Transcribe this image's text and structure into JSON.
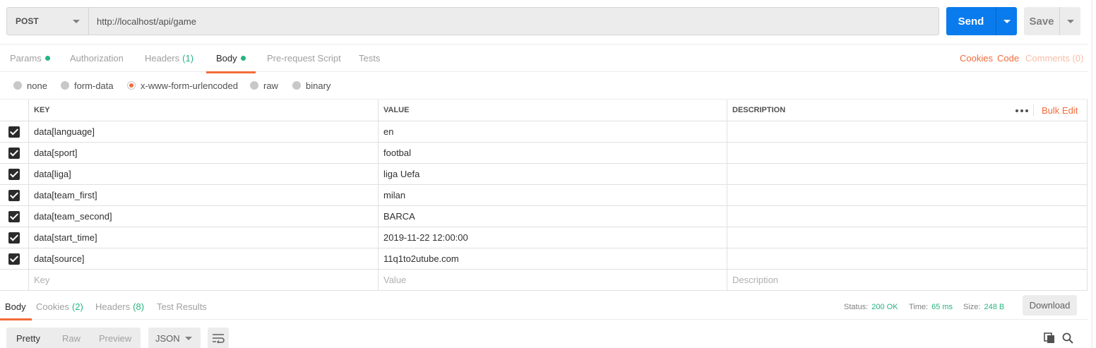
{
  "request": {
    "method": "POST",
    "url": "http://localhost/api/game",
    "send_label": "Send",
    "save_label": "Save"
  },
  "tabs": {
    "params": "Params",
    "authorization": "Authorization",
    "headers": "Headers",
    "headers_count": "(1)",
    "body": "Body",
    "prerequest": "Pre-request Script",
    "tests": "Tests",
    "active": "Body"
  },
  "links": {
    "cookies": "Cookies",
    "code": "Code",
    "comments": "Comments (0)"
  },
  "body_types": {
    "none": "none",
    "form_data": "form-data",
    "urlencoded": "x-www-form-urlencoded",
    "raw": "raw",
    "binary": "binary",
    "selected": "x-www-form-urlencoded"
  },
  "table": {
    "headers": {
      "key": "KEY",
      "value": "VALUE",
      "description": "DESCRIPTION"
    },
    "bulk_edit": "Bulk Edit",
    "rows": [
      {
        "key": "data[language]",
        "value": "en",
        "description": "",
        "checked": true
      },
      {
        "key": "data[sport]",
        "value": "footbal",
        "description": "",
        "checked": true
      },
      {
        "key": "data[liga]",
        "value": "liga Uefa",
        "description": "",
        "checked": true
      },
      {
        "key": "data[team_first]",
        "value": "milan",
        "description": "",
        "checked": true
      },
      {
        "key": "data[team_second]",
        "value": "BARCA",
        "description": "",
        "checked": true
      },
      {
        "key": "data[start_time]",
        "value": "2019-11-22 12:00:00",
        "description": "",
        "checked": true
      },
      {
        "key": "data[source]",
        "value": "11q1to2utube.com",
        "description": "",
        "checked": true
      }
    ],
    "placeholders": {
      "key": "Key",
      "value": "Value",
      "description": "Description"
    }
  },
  "response": {
    "tabs": {
      "body": "Body",
      "cookies": "Cookies",
      "cookies_count": "(2)",
      "headers": "Headers",
      "headers_count": "(8)",
      "test_results": "Test Results"
    },
    "status_label": "Status:",
    "status_value": "200 OK",
    "time_label": "Time:",
    "time_value": "65 ms",
    "size_label": "Size:",
    "size_value": "248 B",
    "download_label": "Download",
    "view_modes": {
      "pretty": "Pretty",
      "raw": "Raw",
      "preview": "Preview"
    },
    "format": "JSON"
  },
  "colors": {
    "accent": "#f26b3a",
    "send": "#097bed",
    "success": "#26b47f"
  },
  "icons": [
    "chevron-down-icon",
    "wrap-lines-icon",
    "copy-icon",
    "search-icon",
    "more-horizontal-icon",
    "checkbox-checked-icon"
  ]
}
